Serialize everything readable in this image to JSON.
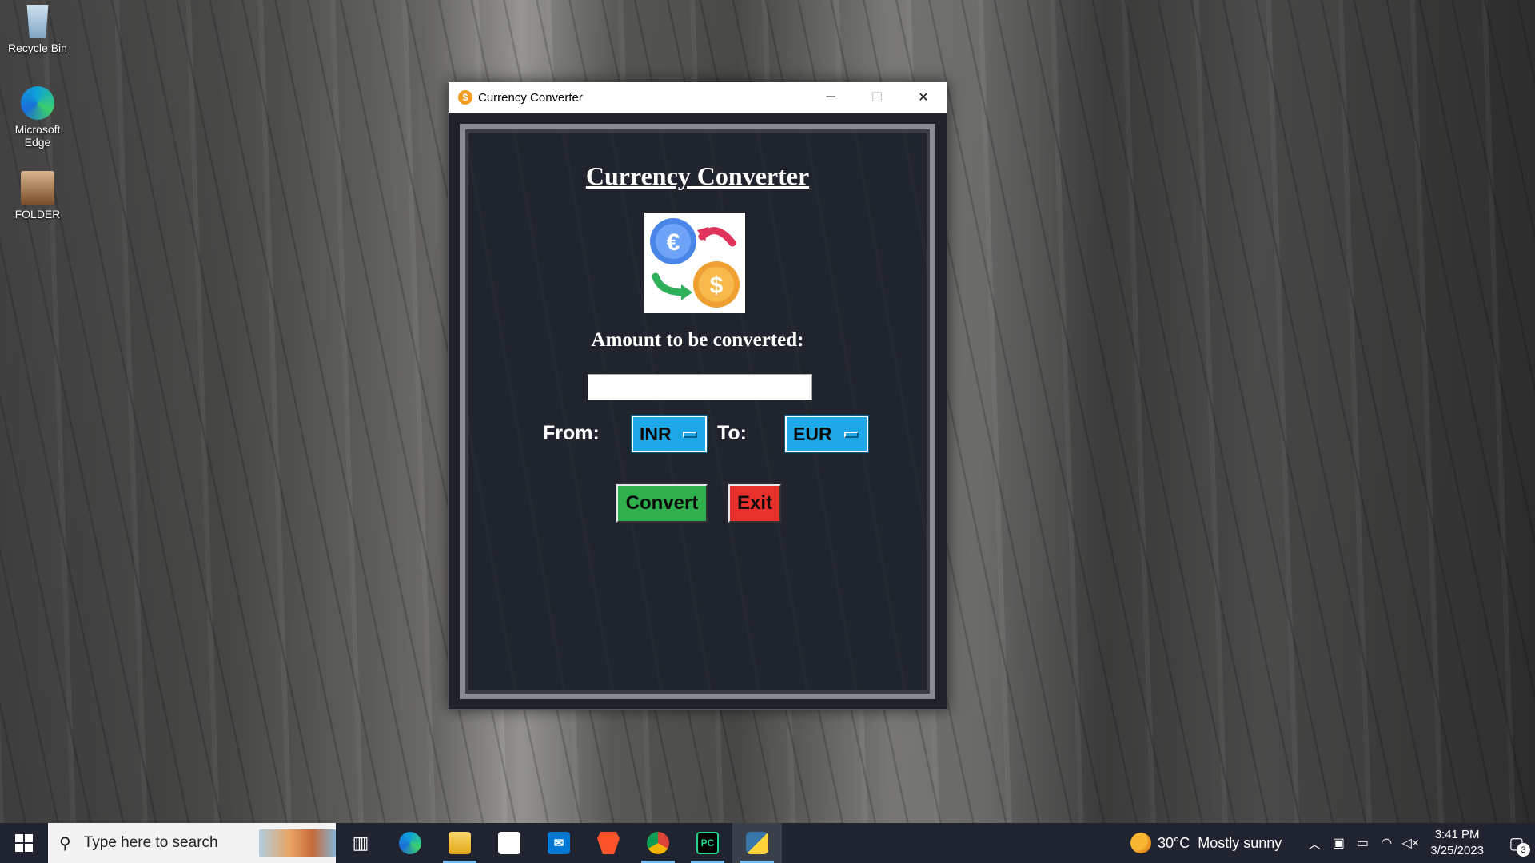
{
  "desktop": {
    "icons": [
      {
        "label": "Recycle Bin",
        "icon": "recycle-bin-icon"
      },
      {
        "label": "Microsoft Edge",
        "icon": "edge-icon"
      },
      {
        "label": "FOLDER",
        "icon": "folder-icon"
      }
    ]
  },
  "window": {
    "title": "Currency Converter",
    "icon_glyph": "$",
    "controls": {
      "minimize": "─",
      "maximize": "☐",
      "close": "✕"
    }
  },
  "app": {
    "heading": "Currency Converter",
    "amount_label": "Amount to be converted:",
    "amount_value": "",
    "from_label": "From:",
    "from_value": "INR",
    "to_label": "To:",
    "to_value": "EUR",
    "convert_button": "Convert",
    "exit_button": "Exit",
    "logo_symbols": {
      "euro": "€",
      "dollar": "$"
    }
  },
  "taskbar": {
    "search_placeholder": "Type here to search",
    "weather": {
      "temp": "30°C",
      "condition": "Mostly sunny"
    },
    "clock": {
      "time": "3:41 PM",
      "date": "3/25/2023"
    },
    "notification_count": "3",
    "pinned": [
      "task-view-icon",
      "edge-icon",
      "file-explorer-icon",
      "store-icon",
      "mail-icon",
      "brave-icon",
      "chrome-icon",
      "pycharm-icon",
      "python-icon"
    ],
    "pycharm_label": "PC"
  },
  "colors": {
    "dropdown": "#1ea8e8",
    "convert": "#2fb04d",
    "exit": "#e8312c",
    "window_bg": "#20242c"
  }
}
